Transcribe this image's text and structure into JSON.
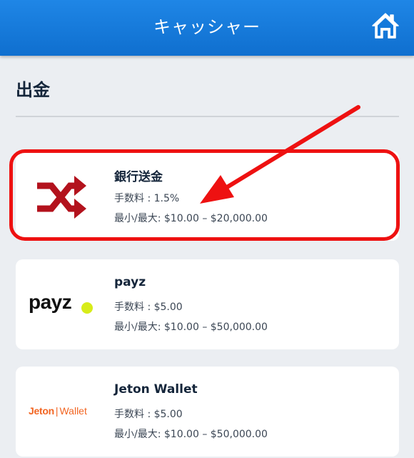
{
  "header": {
    "title": "キャッシャー"
  },
  "section": {
    "title": "出金"
  },
  "methods": [
    {
      "name": "銀行送金",
      "fee": "手数料 : 1.5%",
      "limits": "最小/最大: $10.00 – $20,000.00"
    },
    {
      "name": "payz",
      "fee": "手数料 : $5.00",
      "limits": "最小/最大: $10.00 – $50,000.00"
    },
    {
      "name": "Jeton Wallet",
      "fee": "手数料 : $5.00",
      "limits": "最小/最大: $10.00 – $50,000.00"
    }
  ],
  "logos": {
    "payz": "payz",
    "jeton_brand": "Jeton",
    "jeton_sep": "|",
    "jeton_wallet": "Wallet"
  },
  "icons": {
    "home": "home-icon",
    "bank": "shuffle-icon",
    "annotation": "red-arrow"
  },
  "colors": {
    "header": "#1479db",
    "highlight": "#ee1111",
    "bank_icon": "#b3121d",
    "payz_dot": "#d7ec1a",
    "jeton": "#f26522"
  }
}
